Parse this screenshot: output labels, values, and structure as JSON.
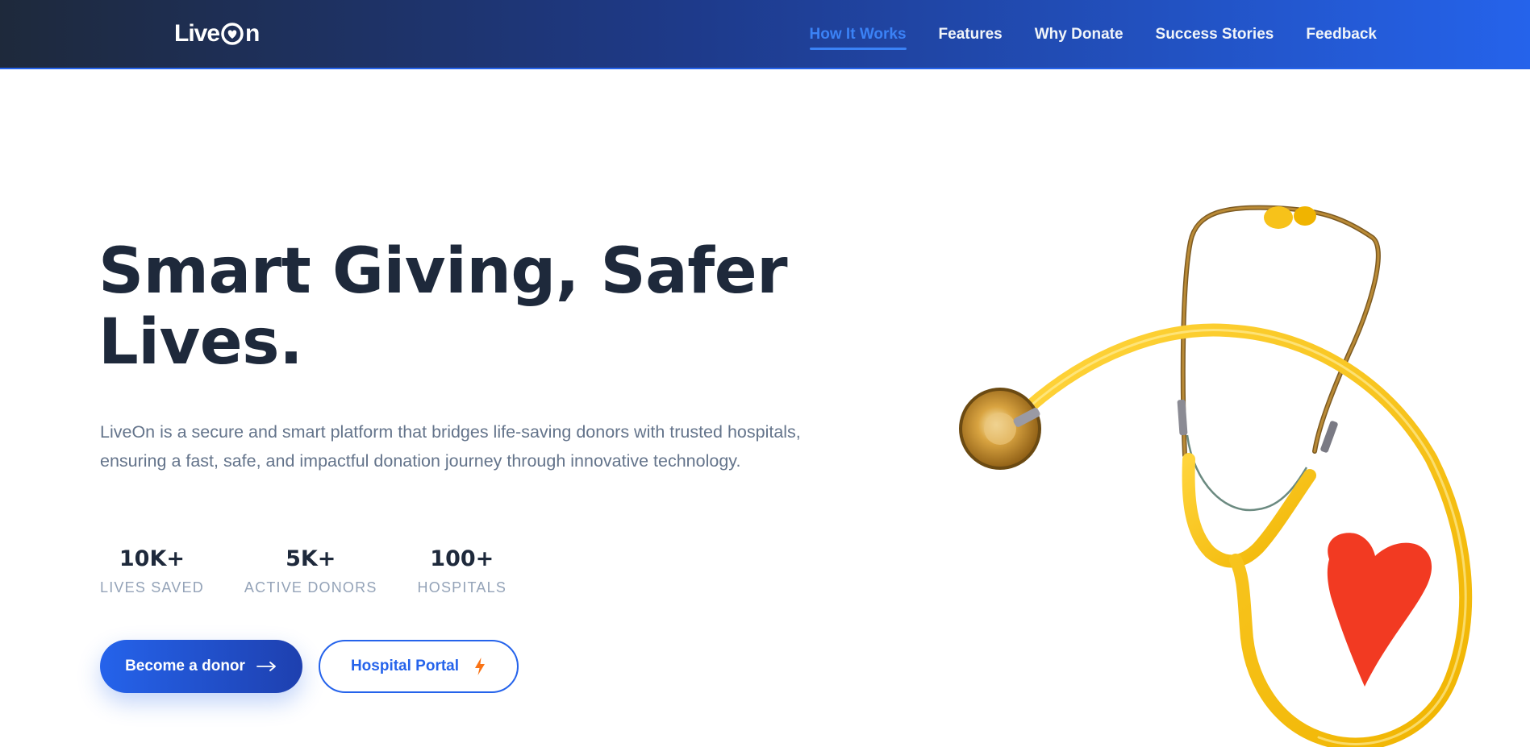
{
  "brand": {
    "name_part1": "Live",
    "name_part2": "n",
    "logo_icon": "heart-icon"
  },
  "nav": {
    "items": [
      {
        "label": "How It Works",
        "active": true
      },
      {
        "label": "Features",
        "active": false
      },
      {
        "label": "Why Donate",
        "active": false
      },
      {
        "label": "Success Stories",
        "active": false
      },
      {
        "label": "Feedback",
        "active": false
      }
    ]
  },
  "hero": {
    "title_line1": "Smart Giving, Safer",
    "title_line2": "Lives.",
    "description_line1": "LiveOn is a secure and smart platform that bridges life-saving donors with trusted hospitals,",
    "description_line2": "ensuring a fast, safe, and impactful donation journey through innovative technology."
  },
  "stats": [
    {
      "value": "10K+",
      "label": "LIVES SAVED"
    },
    {
      "value": "5K+",
      "label": "ACTIVE DONORS"
    },
    {
      "value": "100+",
      "label": "HOSPITALS"
    }
  ],
  "actions": {
    "primary_label": "Become a donor",
    "primary_icon": "arrow-right-icon",
    "secondary_label": "Hospital Portal",
    "secondary_icon": "lightning-icon"
  },
  "colors": {
    "brand_blue": "#2563eb",
    "nav_dark": "#1e293b",
    "heading": "#1e293b",
    "body_text": "#64748b",
    "stat_label": "#94a3b8",
    "accent_orange": "#f97316",
    "stethoscope_yellow": "#f5c21a",
    "heart_red": "#f23a22"
  },
  "illustration": {
    "icon": "stethoscope-heart-image"
  }
}
